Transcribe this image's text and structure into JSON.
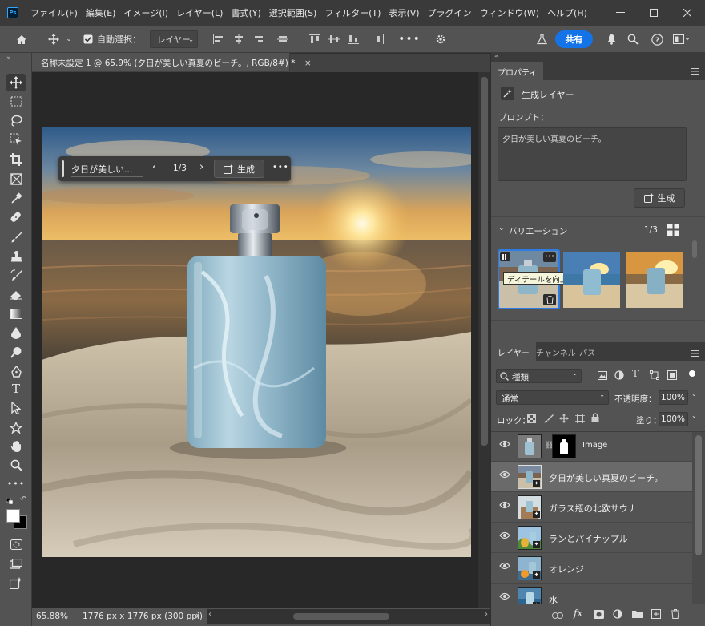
{
  "menubar": {
    "logo": "Ps",
    "items": [
      "ファイル(F)",
      "編集(E)",
      "イメージ(I)",
      "レイヤー(L)",
      "書式(Y)",
      "選択範囲(S)",
      "フィルター(T)",
      "表示(V)",
      "プラグイン",
      "ウィンドウ(W)",
      "ヘルプ(H)"
    ]
  },
  "options_bar": {
    "auto_select_label": "自動選択：",
    "auto_select_target": "レイヤー",
    "share_label": "共有"
  },
  "document": {
    "tab_title": "名称未設定 1 @ 65.9% (夕日が美しい真夏のビーチ。, RGB/8#) *",
    "close": "×"
  },
  "contextual_taskbar": {
    "prompt_preview": "夕日が美しい...",
    "counter": "1/3",
    "generate_label": "生成",
    "more": "•••"
  },
  "status": {
    "zoom": "65.88%",
    "doc_info": "1776 px x 1776 px (300 ppi)",
    "arrow": "›"
  },
  "properties": {
    "tab_label": "プロパティ",
    "layer_type": "生成レイヤー",
    "prompt_label": "プロンプト：",
    "prompt_value": "夕日が美しい真夏のビーチ。",
    "generate_label": "生成",
    "variations_label": "バリエーション",
    "variations_count": "1/3",
    "tooltip": "ディテールを向上"
  },
  "layers_panel": {
    "tabs": [
      "レイヤー",
      "チャンネル",
      "パス"
    ],
    "filter_kind": "種類",
    "blend_mode": "通常",
    "opacity_label": "不透明度：",
    "opacity_value": "100%",
    "lock_label": "ロック：",
    "fill_label": "塗り：",
    "fill_value": "100%",
    "layers": [
      {
        "name": "Image"
      },
      {
        "name": "夕日が美しい真夏のビーチ。"
      },
      {
        "name": "ガラス瓶の北欧サウナ"
      },
      {
        "name": "ランとパイナップル"
      },
      {
        "name": "オレンジ"
      },
      {
        "name": "水"
      }
    ],
    "footer_fx": "fx"
  },
  "colors": {
    "accent": "#1473e6",
    "selected_variation": "#2d7be5",
    "app_dark": "#3a3a3a",
    "panel": "#535353",
    "canvas_bg": "#282828"
  }
}
